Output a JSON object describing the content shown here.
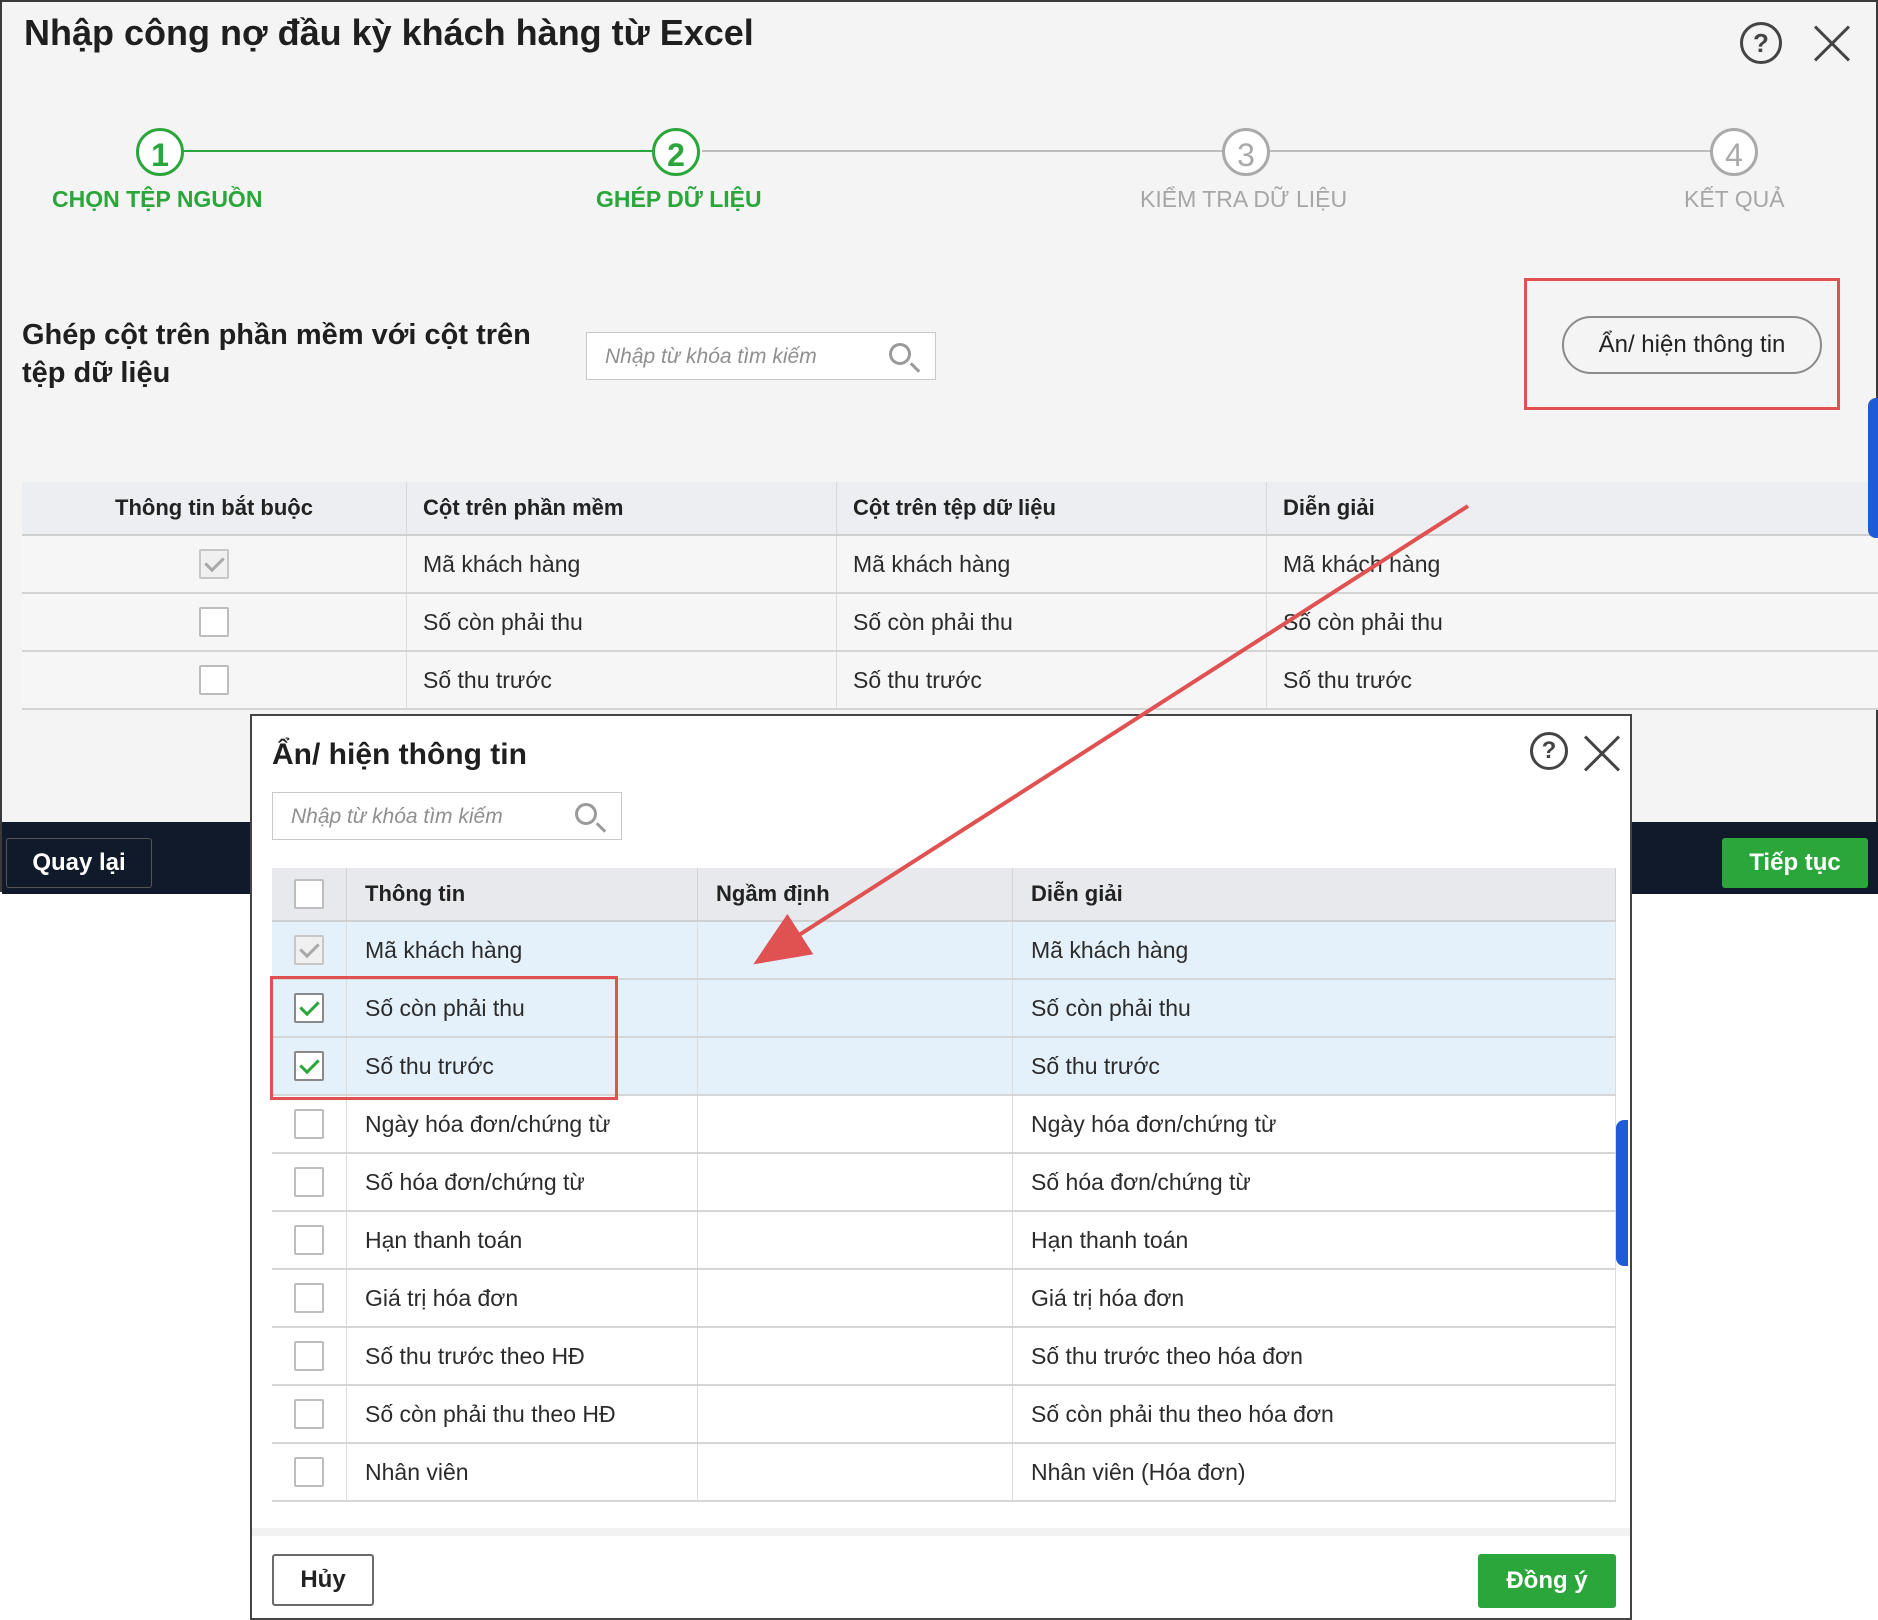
{
  "dialog": {
    "title": "Nhập công nợ đầu kỳ khách hàng từ Excel",
    "help_icon": "?",
    "icons": {
      "help": "help-circle-icon",
      "close": "close-icon"
    }
  },
  "steps": [
    {
      "number": "1",
      "label": "CHỌN TỆP NGUỒN",
      "state": "done"
    },
    {
      "number": "2",
      "label": "GHÉP DỮ LIỆU",
      "state": "active"
    },
    {
      "number": "3",
      "label": "KIỂM TRA DỮ LIỆU",
      "state": "inactive"
    },
    {
      "number": "4",
      "label": "KẾT QUẢ",
      "state": "inactive"
    }
  ],
  "mapping": {
    "title": "Ghép cột trên phần mềm với cột trên tệp dữ liệu",
    "search_placeholder": "Nhập từ khóa tìm kiếm",
    "toggle_label": "Ẩn/ hiện thông tin",
    "columns": [
      "Thông tin bắt buộc",
      "Cột trên phần mềm",
      "Cột trên tệp dữ liệu",
      "Diễn giải"
    ],
    "rows": [
      {
        "required": "checked-disabled",
        "software": "Mã khách hàng",
        "file": "Mã khách hàng",
        "note": "Mã khách hàng"
      },
      {
        "required": "unchecked",
        "software": "Số còn phải thu",
        "file": "Số còn phải thu",
        "note": "Số còn phải thu"
      },
      {
        "required": "unchecked",
        "software": "Số thu trước",
        "file": "Số thu trước",
        "note": "Số thu trước"
      }
    ]
  },
  "footer": {
    "back_label": "Quay lại",
    "next_label": "Tiếp tục"
  },
  "modal": {
    "title": "Ẩn/ hiện thông tin",
    "help_icon": "?",
    "search_placeholder": "Nhập từ khóa tìm kiếm",
    "columns": [
      "Thông tin",
      "Ngầm định",
      "Diễn giải"
    ],
    "rows": [
      {
        "state": "checked-disabled",
        "info": "Mã khách hàng",
        "default": "",
        "note": "Mã khách hàng"
      },
      {
        "state": "checked",
        "info": "Số còn phải thu",
        "default": "",
        "note": "Số còn phải thu"
      },
      {
        "state": "checked",
        "info": "Số thu trước",
        "default": "",
        "note": "Số thu trước"
      },
      {
        "state": "unchecked",
        "info": "Ngày hóa đơn/chứng từ",
        "default": "",
        "note": "Ngày hóa đơn/chứng từ"
      },
      {
        "state": "unchecked",
        "info": "Số hóa đơn/chứng từ",
        "default": "",
        "note": "Số hóa đơn/chứng từ"
      },
      {
        "state": "unchecked",
        "info": "Hạn thanh toán",
        "default": "",
        "note": "Hạn thanh toán"
      },
      {
        "state": "unchecked",
        "info": "Giá trị hóa đơn",
        "default": "",
        "note": "Giá trị hóa đơn"
      },
      {
        "state": "unchecked",
        "info": "Số thu trước theo HĐ",
        "default": "",
        "note": "Số thu trước theo hóa đơn"
      },
      {
        "state": "unchecked",
        "info": "Số còn phải thu theo HĐ",
        "default": "",
        "note": "Số còn phải thu theo hóa đơn"
      },
      {
        "state": "unchecked",
        "info": "Nhân viên",
        "default": "",
        "note": "Nhân viên (Hóa đơn)"
      }
    ],
    "cancel_label": "Hủy",
    "ok_label": "Đồng ý"
  },
  "colors": {
    "accent_green": "#2aa63b",
    "highlight_red": "#e05252",
    "row_highlight": "#e4f1fb",
    "footer_dark": "#111a2a",
    "side_tab_blue": "#1e5bd8"
  }
}
